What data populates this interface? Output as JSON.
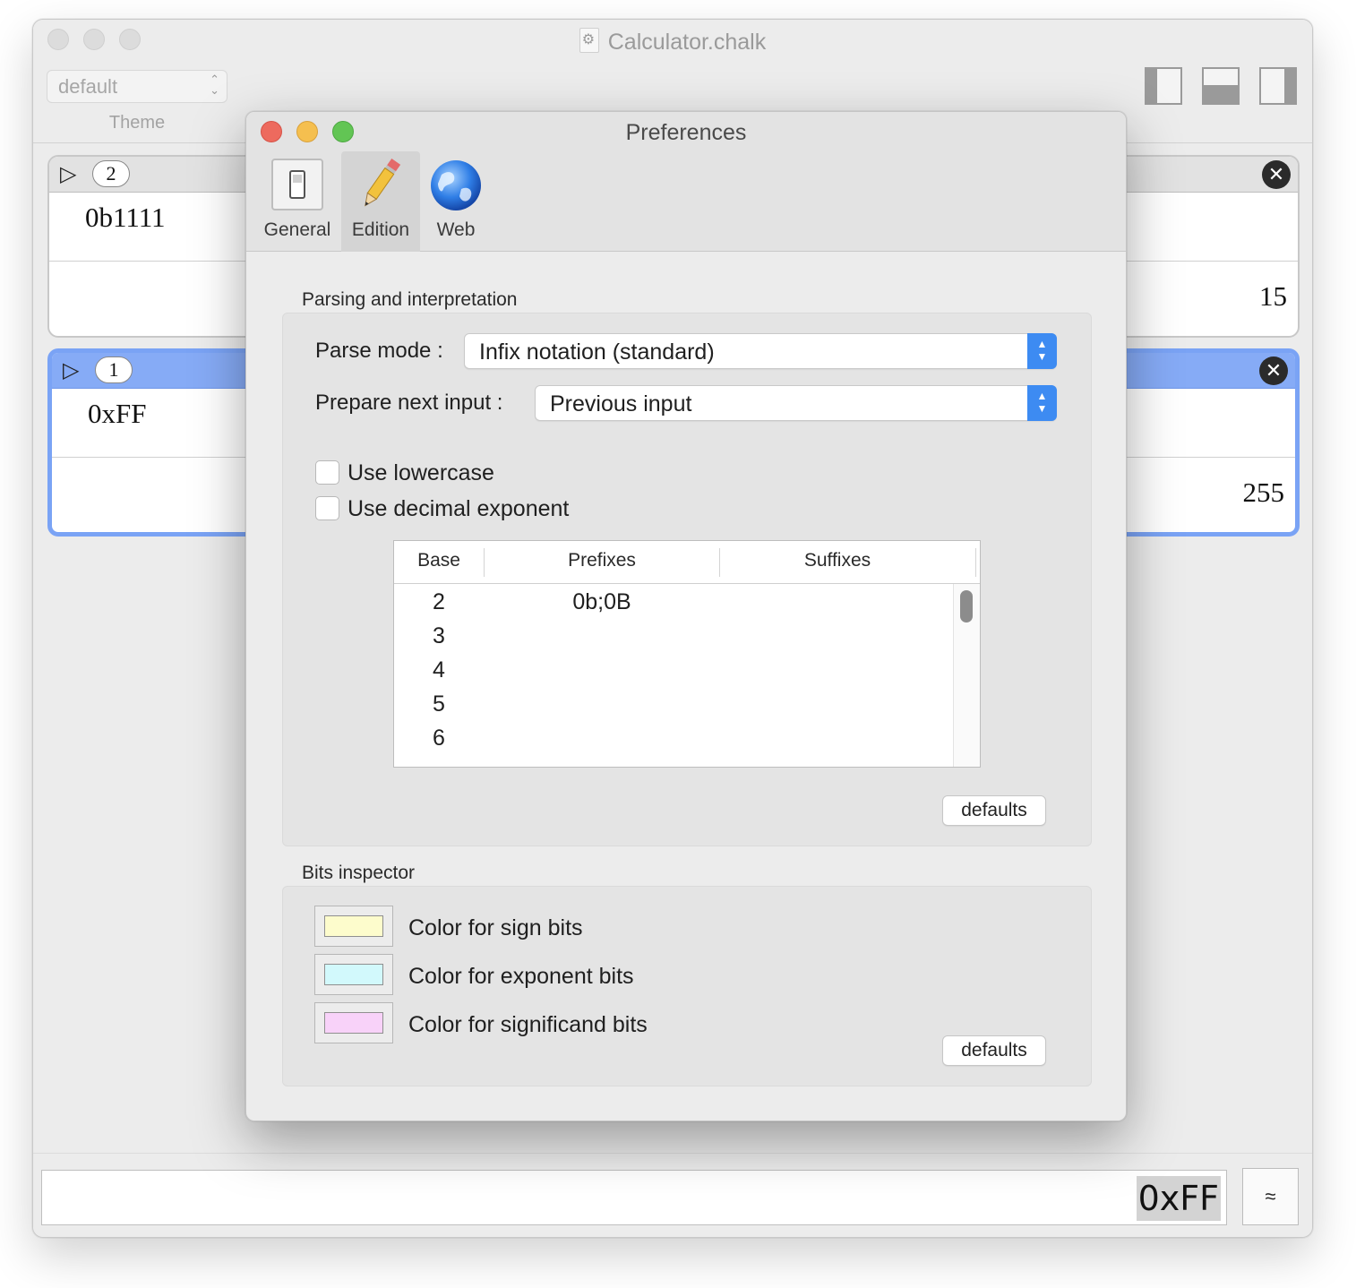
{
  "main_window": {
    "title": "Calculator.chalk",
    "theme_select": {
      "value": "default",
      "label": "Theme"
    },
    "layout_buttons": [
      "layout-left-icon",
      "layout-bottom-icon",
      "layout-right-icon"
    ]
  },
  "cells": [
    {
      "number": "2",
      "input": "0b1111",
      "result": "15",
      "selected": false
    },
    {
      "number": "1",
      "input": "0xFF",
      "result": "255",
      "selected": true
    }
  ],
  "bottom_bar": {
    "input_value": "0xFF",
    "approx_label": "≈"
  },
  "preferences": {
    "title": "Preferences",
    "tabs": [
      {
        "label": "General",
        "icon": "switch-icon",
        "active": false
      },
      {
        "label": "Edition",
        "icon": "pencil-icon",
        "active": true
      },
      {
        "label": "Web",
        "icon": "globe-icon",
        "active": false
      }
    ],
    "parsing": {
      "section_label": "Parsing and interpretation",
      "parse_mode_label": "Parse mode :",
      "parse_mode_value": "Infix notation (standard)",
      "prepare_label": "Prepare next input :",
      "prepare_value": "Previous input",
      "use_lowercase_label": "Use lowercase",
      "use_lowercase_checked": false,
      "use_decimal_exponent_label": "Use decimal exponent",
      "use_decimal_exponent_checked": false,
      "table": {
        "columns": [
          "Base",
          "Prefixes",
          "Suffixes"
        ],
        "rows": [
          {
            "base": "2",
            "prefixes": "0b;0B",
            "suffixes": ""
          },
          {
            "base": "3",
            "prefixes": "",
            "suffixes": ""
          },
          {
            "base": "4",
            "prefixes": "",
            "suffixes": ""
          },
          {
            "base": "5",
            "prefixes": "",
            "suffixes": ""
          },
          {
            "base": "6",
            "prefixes": "",
            "suffixes": ""
          }
        ]
      },
      "defaults_label": "defaults"
    },
    "bits_inspector": {
      "section_label": "Bits inspector",
      "colors": [
        {
          "label": "Color for sign bits",
          "color": "#fdfccc"
        },
        {
          "label": "Color for exponent bits",
          "color": "#d2f9fc"
        },
        {
          "label": "Color for significand bits",
          "color": "#f8d2f9"
        }
      ],
      "defaults_label": "defaults"
    }
  }
}
